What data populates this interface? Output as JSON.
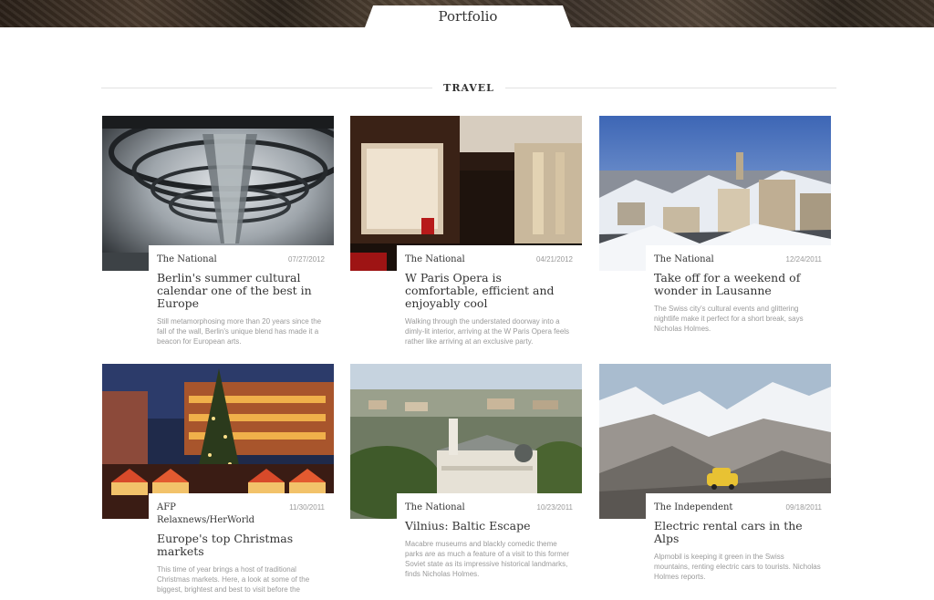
{
  "page": {
    "tab_label": "Portfolio",
    "section_label": "TRAVEL"
  },
  "cards": [
    {
      "image": "reichstag-dome-interior",
      "source": "The National",
      "date": "07/27/2012",
      "title": "Berlin's summer cultural calendar one of the best in Europe",
      "description": "Still metamorphosing more than 20 years since the fall of the wall, Berlin's unique blend has made it a beacon for European arts."
    },
    {
      "image": "hotel-interior",
      "source": "The National",
      "date": "04/21/2012",
      "title": "W Paris Opera is comfortable, efficient and enjoyably cool",
      "description": "Walking through the understated doorway into a dimly-lit interior, arriving at the W Paris Opera feels rather like arriving at an exclusive party."
    },
    {
      "image": "lausanne-snowy-rooftops",
      "source": "The National",
      "date": "12/24/2011",
      "title": "Take off for a weekend of wonder in Lausanne",
      "description": "The Swiss city's cultural events and glittering nightlife make it perfect for a short break, says Nicholas Holmes."
    },
    {
      "image": "christmas-market",
      "source": "AFP Relaxnews/HerWorld",
      "date": "11/30/2011",
      "title": "Europe's top Christmas markets",
      "description": "This time of year brings a host of traditional Christmas markets. Here, a look at some of the biggest, brightest and best to visit before the"
    },
    {
      "image": "vilnius-cityscape",
      "source": "The National",
      "date": "10/23/2011",
      "title": "Vilnius: Baltic Escape",
      "description": "Macabre museums and blackly comedic theme parks are as much a feature of a visit to this former Soviet state as its impressive historical landmarks, finds Nicholas Holmes."
    },
    {
      "image": "alps-yellow-car",
      "source": "The Independent",
      "date": "09/18/2011",
      "title": "Electric rental cars in the Alps",
      "description": "Alpmobil is keeping it green in the Swiss mountains, renting electric cars to tourists. Nicholas Holmes reports."
    }
  ]
}
